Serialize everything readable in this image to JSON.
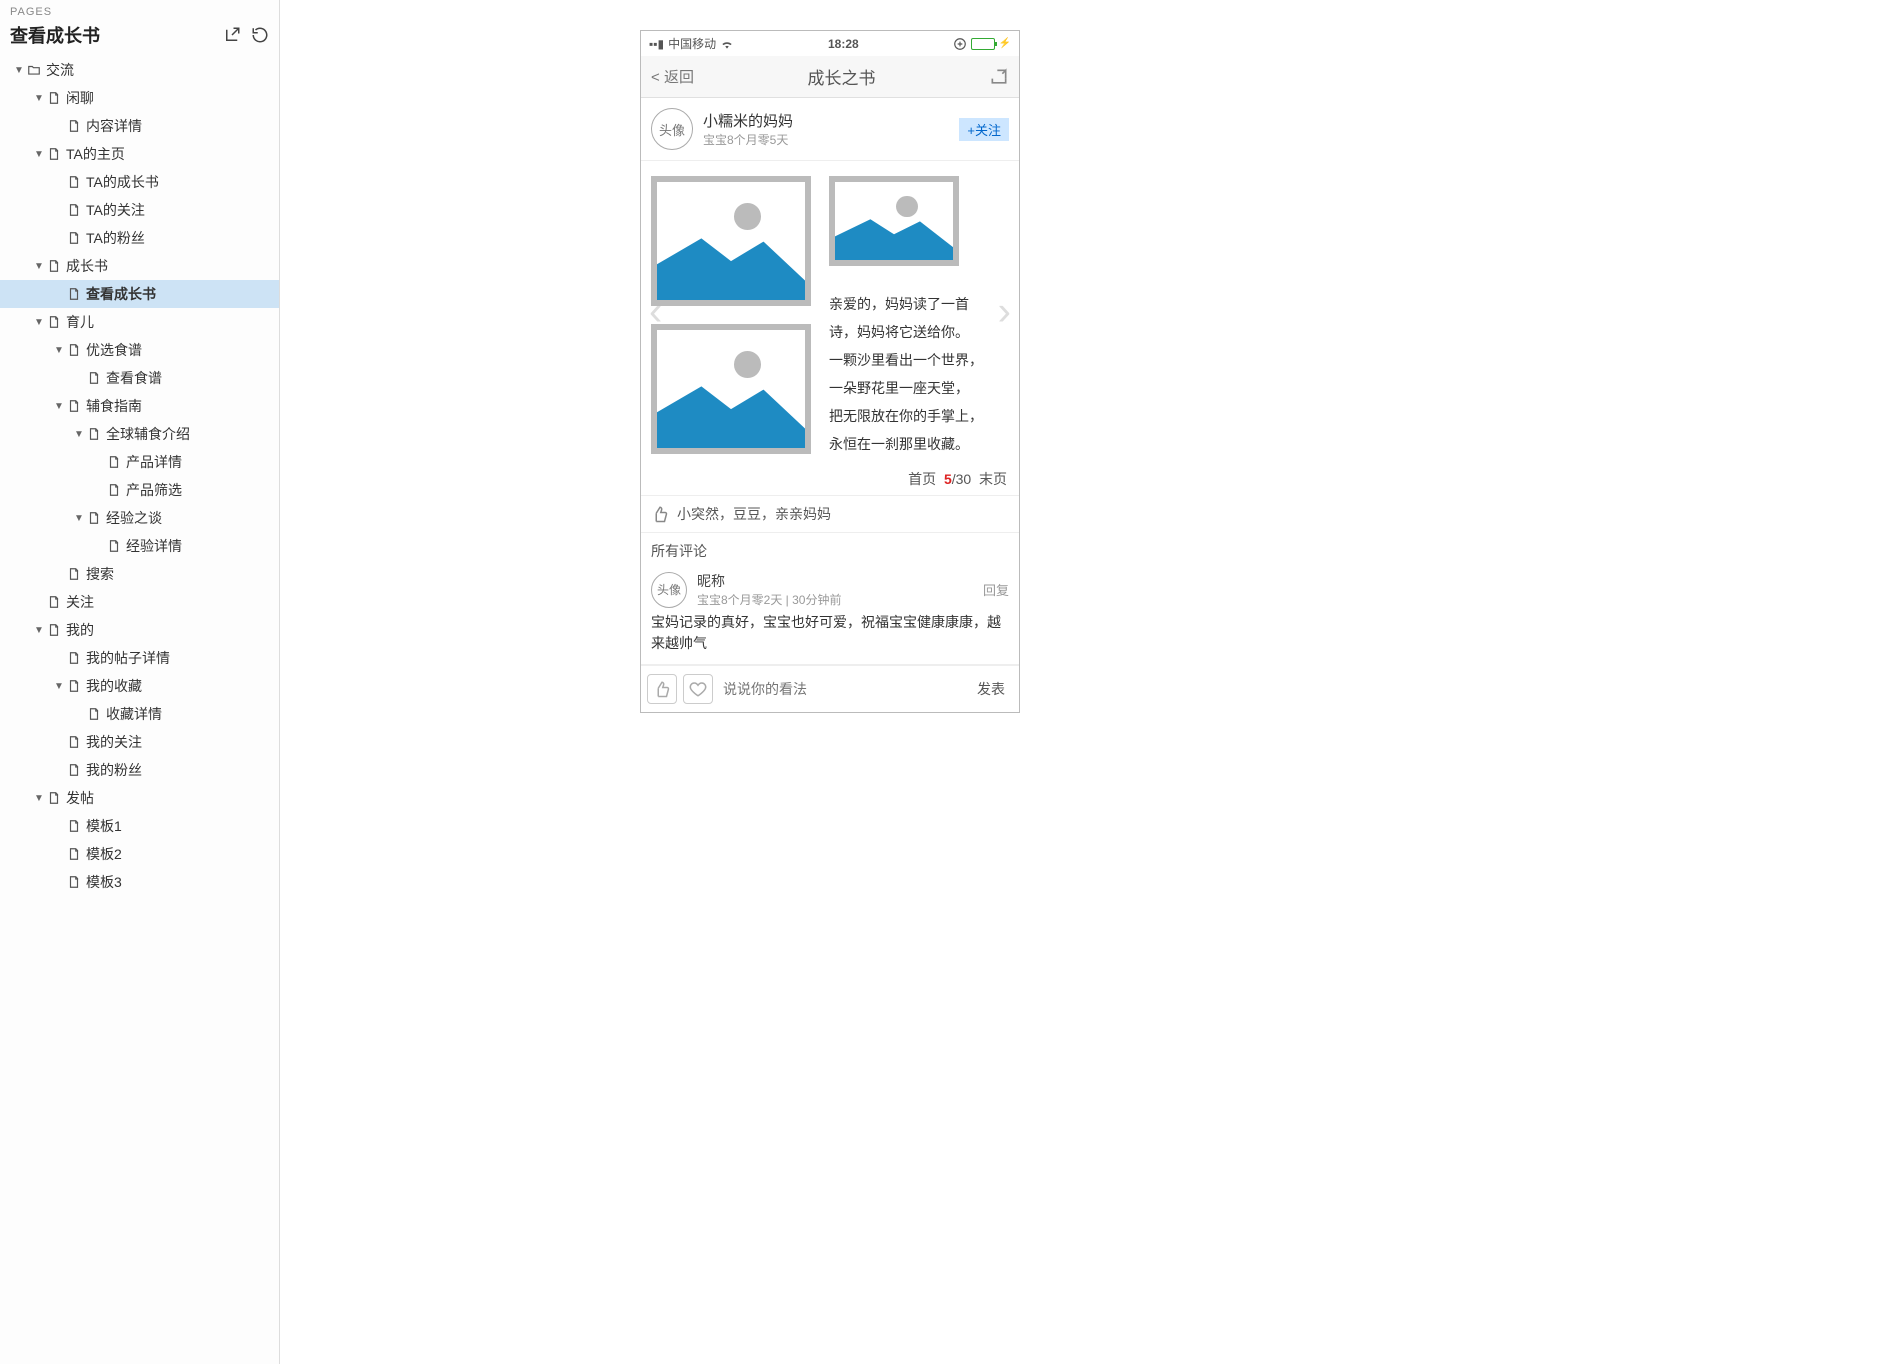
{
  "sidebar": {
    "label": "PAGES",
    "title": "查看成长书",
    "tree": [
      {
        "depth": 0,
        "expand": true,
        "icon": "folder",
        "text": "交流"
      },
      {
        "depth": 1,
        "expand": true,
        "icon": "page",
        "text": "闲聊"
      },
      {
        "depth": 2,
        "expand": null,
        "icon": "page",
        "text": "内容详情"
      },
      {
        "depth": 1,
        "expand": true,
        "icon": "page",
        "text": "TA的主页"
      },
      {
        "depth": 2,
        "expand": null,
        "icon": "page",
        "text": "TA的成长书"
      },
      {
        "depth": 2,
        "expand": null,
        "icon": "page",
        "text": "TA的关注"
      },
      {
        "depth": 2,
        "expand": null,
        "icon": "page",
        "text": "TA的粉丝"
      },
      {
        "depth": 1,
        "expand": true,
        "icon": "page",
        "text": "成长书"
      },
      {
        "depth": 2,
        "expand": null,
        "icon": "page",
        "text": "查看成长书",
        "selected": true
      },
      {
        "depth": 1,
        "expand": true,
        "icon": "page",
        "text": "育儿"
      },
      {
        "depth": 2,
        "expand": true,
        "icon": "page",
        "text": "优选食谱"
      },
      {
        "depth": 3,
        "expand": null,
        "icon": "page",
        "text": "查看食谱"
      },
      {
        "depth": 2,
        "expand": true,
        "icon": "page",
        "text": "辅食指南"
      },
      {
        "depth": 3,
        "expand": true,
        "icon": "page",
        "text": "全球辅食介绍"
      },
      {
        "depth": 4,
        "expand": null,
        "icon": "page",
        "text": "产品详情"
      },
      {
        "depth": 4,
        "expand": null,
        "icon": "page",
        "text": "产品筛选"
      },
      {
        "depth": 3,
        "expand": true,
        "icon": "page",
        "text": "经验之谈"
      },
      {
        "depth": 4,
        "expand": null,
        "icon": "page",
        "text": "经验详情"
      },
      {
        "depth": 2,
        "expand": null,
        "icon": "page",
        "text": "搜索"
      },
      {
        "depth": 1,
        "expand": null,
        "icon": "page",
        "text": "关注"
      },
      {
        "depth": 1,
        "expand": true,
        "icon": "page",
        "text": "我的"
      },
      {
        "depth": 2,
        "expand": null,
        "icon": "page",
        "text": "我的帖子详情"
      },
      {
        "depth": 2,
        "expand": true,
        "icon": "page",
        "text": "我的收藏"
      },
      {
        "depth": 3,
        "expand": null,
        "icon": "page",
        "text": "收藏详情"
      },
      {
        "depth": 2,
        "expand": null,
        "icon": "page",
        "text": "我的关注"
      },
      {
        "depth": 2,
        "expand": null,
        "icon": "page",
        "text": "我的粉丝"
      },
      {
        "depth": 1,
        "expand": true,
        "icon": "page",
        "text": "发帖"
      },
      {
        "depth": 2,
        "expand": null,
        "icon": "page",
        "text": "模板1"
      },
      {
        "depth": 2,
        "expand": null,
        "icon": "page",
        "text": "模板2"
      },
      {
        "depth": 2,
        "expand": null,
        "icon": "page",
        "text": "模板3"
      }
    ]
  },
  "mock": {
    "status": {
      "carrier": "中国移动",
      "time": "18:28"
    },
    "nav": {
      "back": "返回",
      "title": "成长之书"
    },
    "author": {
      "avatar": "头像",
      "name": "小糯米的妈妈",
      "sub": "宝宝8个月零5天",
      "follow": "+关注"
    },
    "poem": {
      "l1": "亲爱的，妈妈读了一首",
      "l2": "诗，妈妈将它送给你。",
      "l3": "一颗沙里看出一个世界，",
      "l4": "一朵野花里一座天堂，",
      "l5": "把无限放在你的手掌上，",
      "l6": "永恒在一刹那里收藏。"
    },
    "pager": {
      "first": "首页",
      "cur": "5",
      "sep": "/",
      "total": "30",
      "last": "末页"
    },
    "likes": "小突然，豆豆，亲亲妈妈",
    "comments_title": "所有评论",
    "comment": {
      "avatar": "头像",
      "name": "昵称",
      "sub": "宝宝8个月零2天 |  30分钟前",
      "reply": "回复",
      "body": "宝妈记录的真好，宝宝也好可爱，祝福宝宝健康康康，越来越帅气"
    },
    "composer": {
      "placeholder": "说说你的看法",
      "send": "发表"
    }
  }
}
